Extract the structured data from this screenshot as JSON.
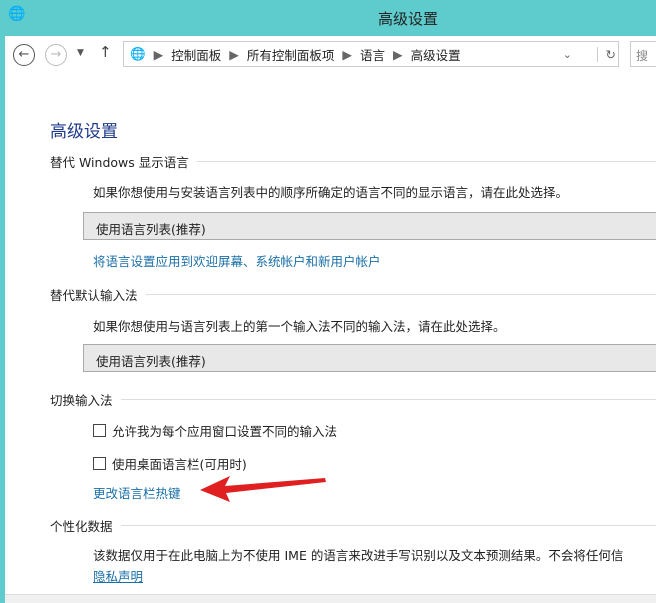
{
  "window": {
    "title": "高级设置",
    "accent": "#5ecccc"
  },
  "nav": {
    "breadcrumb": [
      "控制面板",
      "所有控制面板项",
      "语言",
      "高级设置"
    ],
    "search_placeholder": "搜"
  },
  "page": {
    "title": "高级设置",
    "display_language": {
      "heading": "替代 Windows 显示语言",
      "description": "如果你想使用与安装语言列表中的顺序所确定的语言不同的显示语言，请在此处选择。",
      "dropdown": "使用语言列表(推荐)",
      "link": "将语言设置应用到欢迎屏幕、系统帐户和新用户帐户"
    },
    "input_method": {
      "heading": "替代默认输入法",
      "description": "如果你想使用与语言列表上的第一个输入法不同的输入法，请在此处选择。",
      "dropdown": "使用语言列表(推荐)"
    },
    "switch": {
      "heading": "切换输入法",
      "checkbox1": "允许我为每个应用窗口设置不同的输入法",
      "checkbox2": "使用桌面语言栏(可用时)",
      "checkbox1_checked": false,
      "checkbox2_checked": false,
      "link": "更改语言栏热键"
    },
    "personal": {
      "heading": "个性化数据",
      "description": "该数据仅用于在此电脑上为不使用 IME 的语言来改进手写识别以及文本预测结果。不会将任何信",
      "link": "隐私声明"
    }
  },
  "annotation": {
    "arrow_color": "#e02020"
  }
}
